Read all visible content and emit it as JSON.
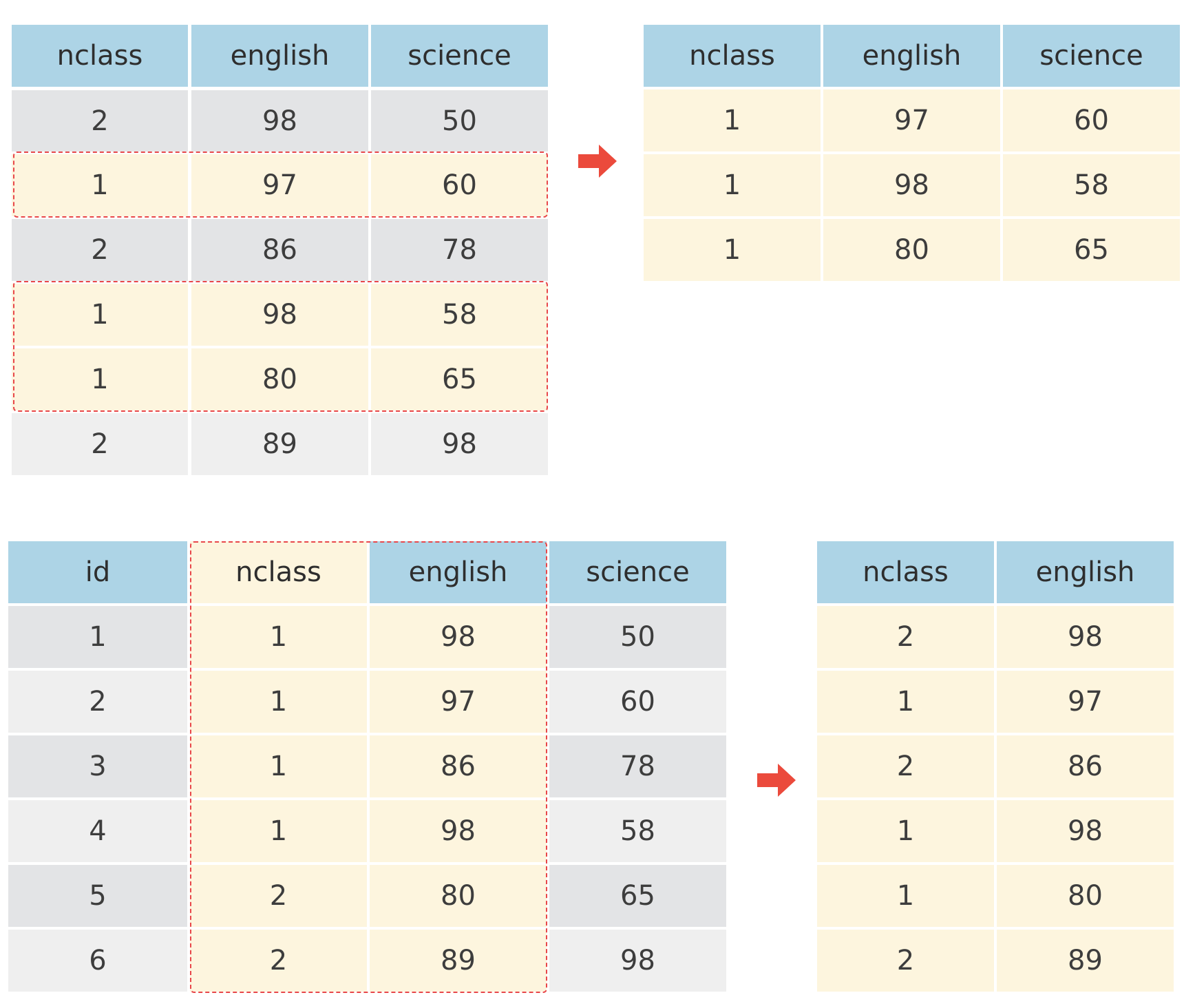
{
  "table1": {
    "headers": [
      "nclass",
      "english",
      "science"
    ],
    "rows": [
      [
        "2",
        "98",
        "50"
      ],
      [
        "1",
        "97",
        "60"
      ],
      [
        "2",
        "86",
        "78"
      ],
      [
        "1",
        "98",
        "58"
      ],
      [
        "1",
        "80",
        "65"
      ],
      [
        "2",
        "89",
        "98"
      ]
    ]
  },
  "table2": {
    "headers": [
      "nclass",
      "english",
      "science"
    ],
    "rows": [
      [
        "1",
        "97",
        "60"
      ],
      [
        "1",
        "98",
        "58"
      ],
      [
        "1",
        "80",
        "65"
      ]
    ]
  },
  "table3": {
    "headers": [
      "id",
      "nclass",
      "english",
      "science"
    ],
    "rows": [
      [
        "1",
        "1",
        "98",
        "50"
      ],
      [
        "2",
        "1",
        "97",
        "60"
      ],
      [
        "3",
        "1",
        "86",
        "78"
      ],
      [
        "4",
        "1",
        "98",
        "58"
      ],
      [
        "5",
        "2",
        "80",
        "65"
      ],
      [
        "6",
        "2",
        "89",
        "98"
      ]
    ]
  },
  "table4": {
    "headers": [
      "nclass",
      "english"
    ],
    "rows": [
      [
        "2",
        "98"
      ],
      [
        "1",
        "97"
      ],
      [
        "2",
        "86"
      ],
      [
        "1",
        "98"
      ],
      [
        "1",
        "80"
      ],
      [
        "2",
        "89"
      ]
    ]
  },
  "colors": {
    "header": "#add4e6",
    "row_gray_dark": "#e3e4e6",
    "row_gray_light": "#efefef",
    "row_highlight": "#fdf5de",
    "selection_dash": "#e8474a",
    "arrow": "#eb4a3c"
  },
  "icons": [
    "right-arrow-icon"
  ]
}
